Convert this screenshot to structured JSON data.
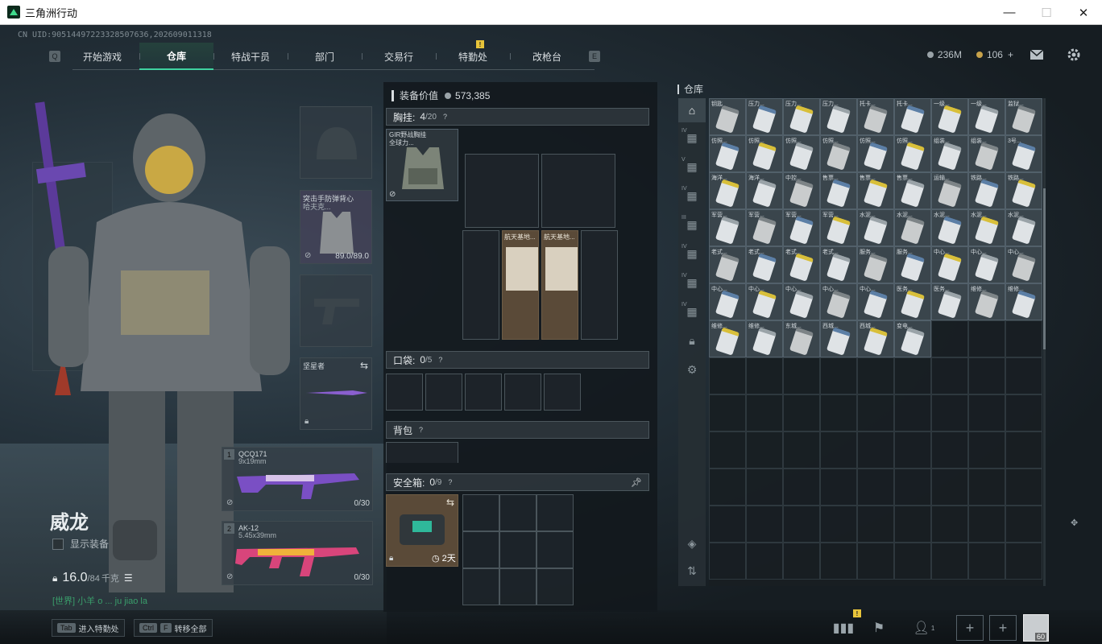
{
  "window": {
    "title": "三角洲行动",
    "minimize": "—",
    "maximize": "☐",
    "close": "✕"
  },
  "uid": "CN UID:9051449722332850763​6,2026090113​18",
  "nav": {
    "left_key": "Q",
    "right_key": "E",
    "tabs": [
      "开始游戏",
      "仓库",
      "特战干员",
      "部门",
      "交易行",
      "特勤处",
      "改枪台"
    ],
    "active_tab": "仓库",
    "badge_tab": "特勤处",
    "badge": "!"
  },
  "resources": {
    "silver": "236M",
    "gold": "106",
    "gold_add": "+"
  },
  "operator": {
    "name": "威龙",
    "show_equipment": "显示装备",
    "weight_current": "16.0",
    "weight_max": "/84",
    "weight_unit": "千克",
    "chat": "[世界] 小羊 o ... ju jiao la"
  },
  "equip_slots": {
    "armor_label": "突击手防弹背心",
    "armor_sub": "哈夫克...",
    "armor_durability": "89.0/89.0",
    "melee_label": "坚星者",
    "primary_num": "1",
    "primary_name": "QCQ171",
    "primary_caliber": "9x19mm",
    "primary_ammo": "0/30",
    "secondary_num": "2",
    "secondary_name": "AK-12",
    "secondary_caliber": "5.45x39mm",
    "secondary_ammo": "0/30"
  },
  "loadout": {
    "equip_value_label": "装备价值",
    "equip_value": "573,385",
    "chest_label": "胸挂:",
    "chest_count": "4",
    "chest_cap": "/20",
    "chest_item": "GIR野战胸挂",
    "chest_item_sub": "全球力...",
    "map_item_1": "航天基地...",
    "map_item_2": "航天基地...",
    "pocket_label": "口袋:",
    "pocket_count": "0",
    "pocket_cap": "/5",
    "backpack_label": "背包",
    "safebox_label": "安全箱:",
    "safebox_count": "0",
    "safebox_cap": "/9",
    "safebox_time": "2天",
    "help": "?"
  },
  "warehouse": {
    "title": "仓库",
    "items": [
      "钥匙",
      "压力...",
      "压力...",
      "压力...",
      "托卡...",
      "托卡...",
      "一级...",
      "一级...",
      "监狱...",
      "仿照...",
      "仿照...",
      "仿照...",
      "仿照...",
      "仿照...",
      "仿照...",
      "组装...",
      "组装...",
      "3号...",
      "海洋...",
      "海洋...",
      "中控...",
      "售票...",
      "售票...",
      "售票...",
      "运输...",
      "铁路...",
      "铁路...",
      "军营...",
      "军营...",
      "军营...",
      "军营...",
      "水泥...",
      "水泥...",
      "水泥...",
      "水泥...",
      "水泥...",
      "老式...",
      "老式...",
      "老式...",
      "老式...",
      "服务...",
      "服务...",
      "中心...",
      "中心...",
      "中心...",
      "中心...",
      "中心...",
      "中心...",
      "中心...",
      "中心...",
      "医务...",
      "医务...",
      "维修...",
      "维修...",
      "维修...",
      "维修...",
      "东城...",
      "西城...",
      "西城...",
      "变电..."
    ],
    "side_lvl": [
      "",
      "IV",
      "V",
      "IV",
      "III",
      "IV",
      "IV",
      "IV"
    ]
  },
  "bottom": {
    "hint1_key": "Tab",
    "hint1": "进入特勤处",
    "hint2_key1": "Ctrl",
    "hint2_key2": "F",
    "hint2": "转移全部",
    "badge": "!",
    "friends": "1",
    "plus": "+",
    "level": "60"
  }
}
